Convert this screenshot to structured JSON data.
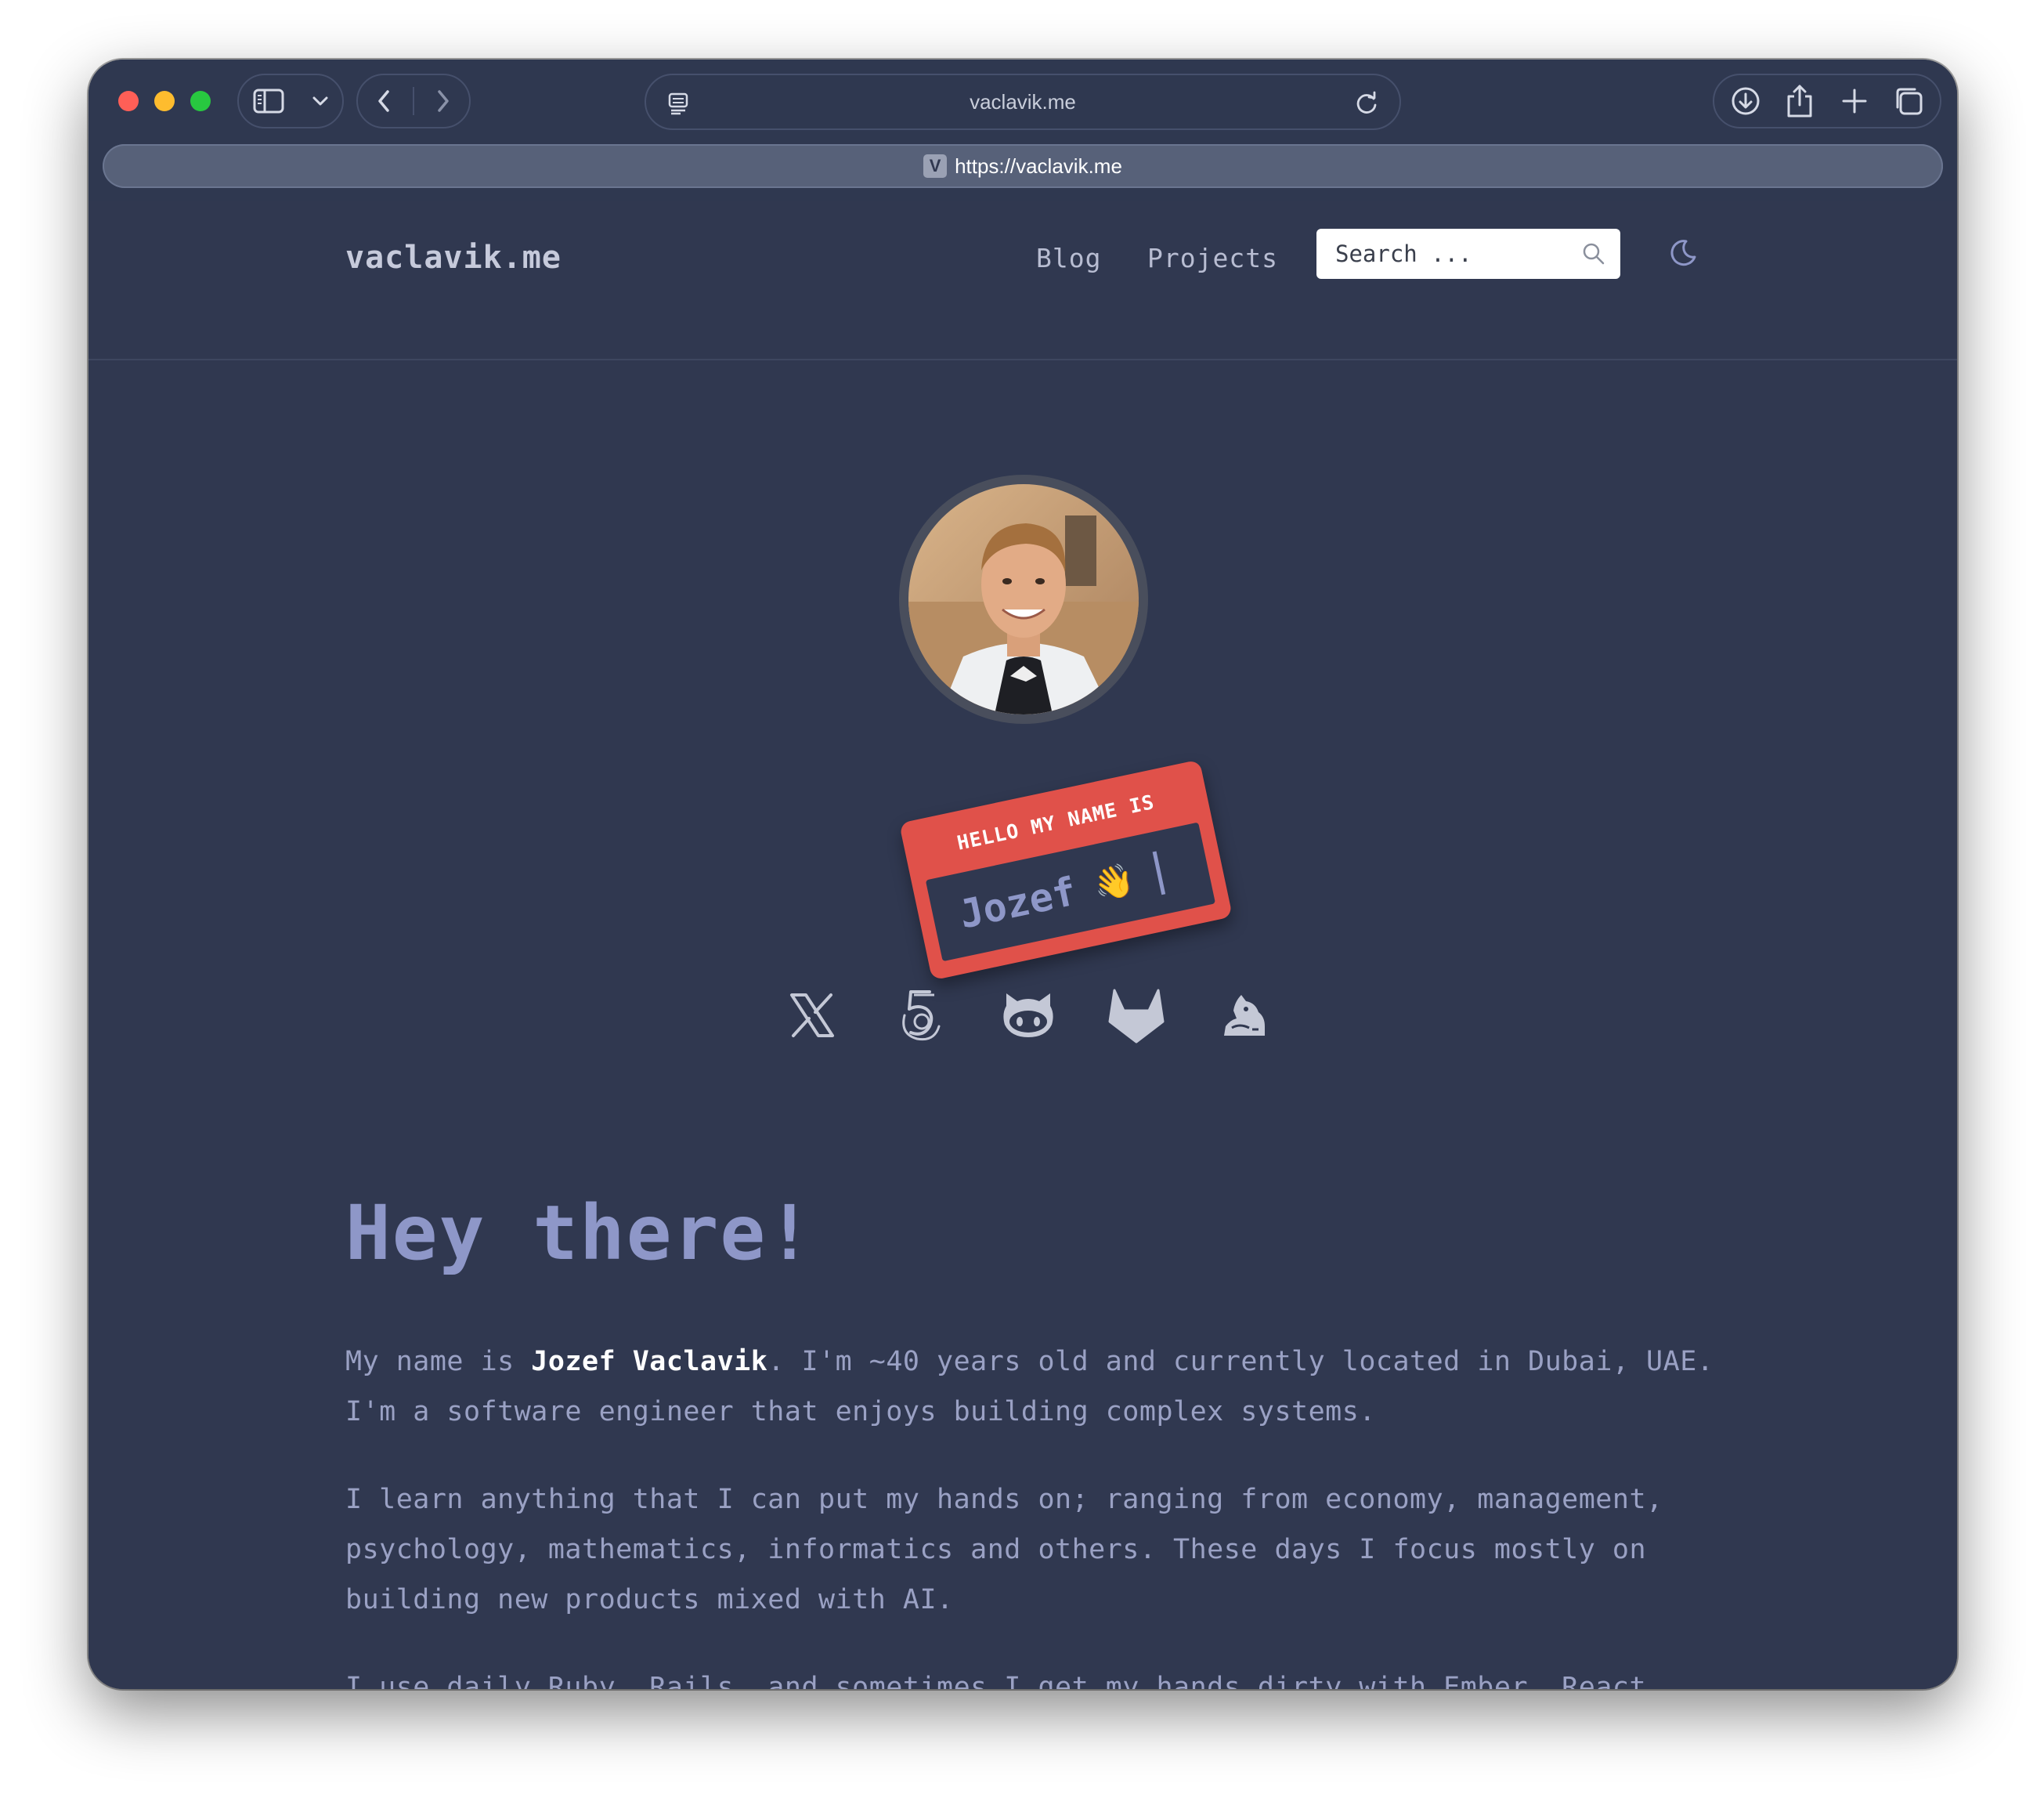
{
  "browser": {
    "address_host": "vaclavik.me",
    "tab_url": "https://vaclavik.me",
    "tab_favicon_letter": "V",
    "icons": {
      "sidebar": "sidebar-icon",
      "chevron": "chevron-down-icon",
      "back": "back-arrow-icon",
      "forward": "forward-arrow-icon",
      "reader": "reader-icon",
      "reload": "reload-icon",
      "download": "download-icon",
      "share": "share-icon",
      "new_tab": "plus-icon",
      "tabs_overview": "tabs-overview-icon"
    }
  },
  "site": {
    "title": "vaclavik.me",
    "nav": {
      "blog": "Blog",
      "projects": "Projects"
    },
    "search_placeholder": "Search ...",
    "colors": {
      "background": "#303850",
      "accent": "#8e97c8",
      "badge": "#e0514a"
    }
  },
  "badge": {
    "top": "HELLO MY NAME IS",
    "name": "Jozef",
    "emoji": "👋"
  },
  "social": [
    {
      "name": "x-icon"
    },
    {
      "name": "stackoverflow-icon"
    },
    {
      "name": "github-icon"
    },
    {
      "name": "gitlab-icon"
    },
    {
      "name": "mastodon-icon"
    }
  ],
  "content": {
    "heading": "Hey there!",
    "p1_prefix": "My name is ",
    "p1_name": "Jozef Vaclavik",
    "p1_suffix": ". I'm ~40 years old and currently located in Dubai, UAE. I'm a software engineer that enjoys building complex systems.",
    "p2": "I learn anything that I can put my hands on; ranging from economy, management, psychology, mathematics, informatics and others. These days I focus mostly on building new products mixed with AI.",
    "p3": "I use daily Ruby, Rails, and sometimes I get my hands dirty with Ember, React, Phoenix and Elixir. Occasionally I do Cocoa with Objective-C (but tbh that has"
  }
}
